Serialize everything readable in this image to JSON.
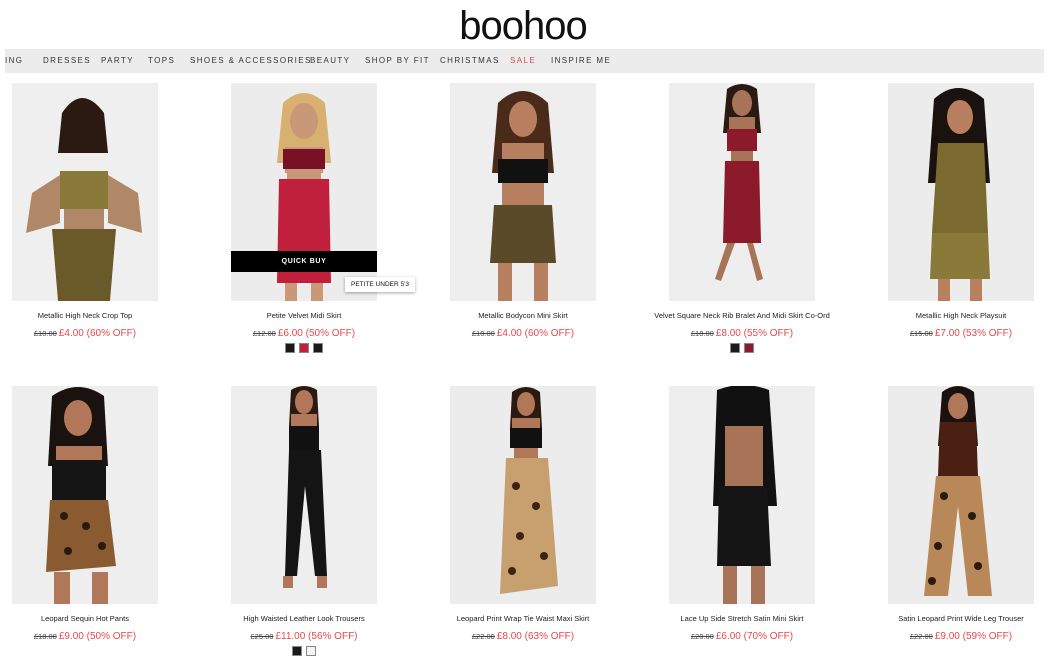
{
  "brand": {
    "logo_text": "boohoo"
  },
  "nav": {
    "items": [
      "ING",
      "DRESSES",
      "PARTY",
      "TOPS",
      "SHOES & ACCESSORIES",
      "BEAUTY",
      "SHOP BY FIT",
      "CHRISTMAS",
      "SALE",
      "INSPIRE ME"
    ],
    "sale_color": "#e8474c"
  },
  "products": [
    {
      "name": "Metallic High Neck Crop Top",
      "was": "£10.00",
      "now": "£4.00 (60% OFF)",
      "swatches": []
    },
    {
      "name": "Petite Velvet Midi Skirt",
      "was": "£12.00",
      "now": "£6.00 (50% OFF)",
      "swatches": [
        "#1a1a1a",
        "#c0203c",
        "#1a1a1a"
      ],
      "quick_buy": "QUICK BUY",
      "badge": "PETITE UNDER 5'3"
    },
    {
      "name": "Metallic Bodycon Mini Skirt",
      "was": "£10.00",
      "now": "£4.00 (60% OFF)",
      "swatches": []
    },
    {
      "name": "Velvet Square Neck Rib Bralet And Midi Skirt Co-Ord",
      "was": "£18.00",
      "now": "£8.00 (55% OFF)",
      "swatches": [
        "#1a1a1a",
        "#8b1a2a"
      ]
    },
    {
      "name": "Metallic High Neck Playsuit",
      "was": "£15.00",
      "now": "£7.00 (53% OFF)",
      "swatches": []
    },
    {
      "name": "Leopard Sequin Hot Pants",
      "was": "£18.00",
      "now": "£9.00 (50% OFF)",
      "swatches": []
    },
    {
      "name": "High Waisted Leather Look Trousers",
      "was": "£25.00",
      "now": "£11.00 (56% OFF)",
      "swatches": [
        "#1a1a1a",
        "#f4f4f4"
      ]
    },
    {
      "name": "Leopard Print Wrap Tie Waist Maxi Skirt",
      "was": "£22.00",
      "now": "£8.00 (63% OFF)",
      "swatches": []
    },
    {
      "name": "Lace Up Side Stretch Satin Mini Skirt",
      "was": "£20.00",
      "now": "£6.00 (70% OFF)",
      "swatches": []
    },
    {
      "name": "Satin Leopard Print Wide Leg Trouser",
      "was": "£22.00",
      "now": "£9.00 (59% OFF)",
      "swatches": []
    }
  ]
}
